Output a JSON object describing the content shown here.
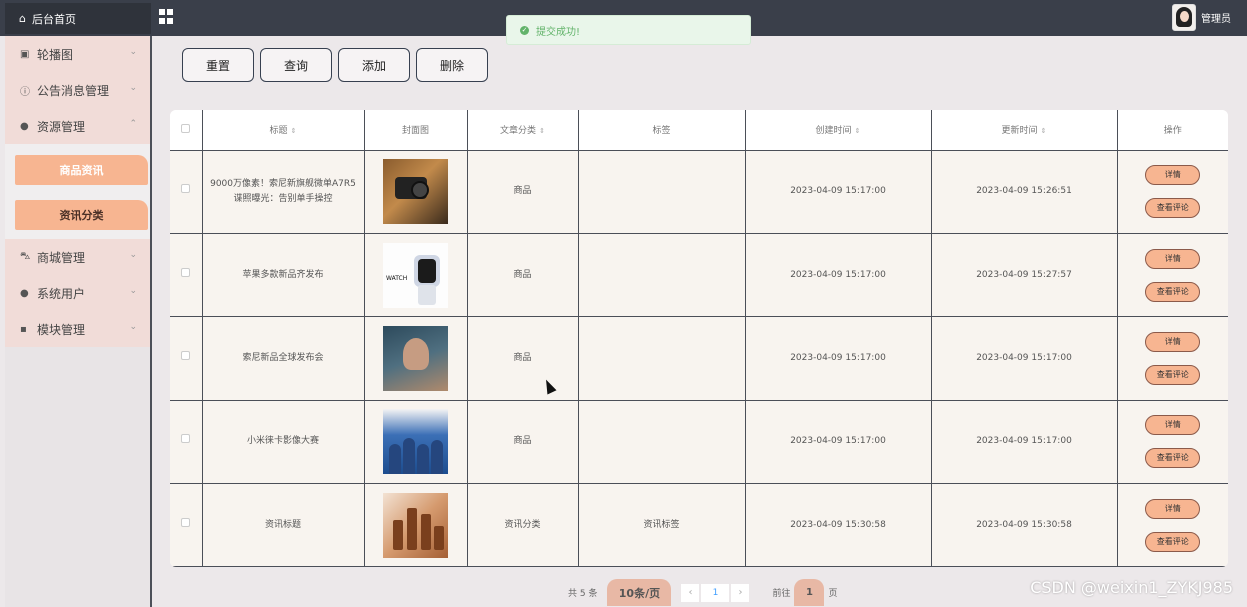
{
  "topbar": {
    "home_label": "后台首页",
    "admin_label": "管理员",
    "toast_text": "提交成功!",
    "toast_color": "#62b36a"
  },
  "sidebar": {
    "items": [
      {
        "label": "轮播图",
        "icon": "image-icon"
      },
      {
        "label": "公告消息管理",
        "icon": "info-circle-icon"
      },
      {
        "label": "资源管理",
        "icon": "location-icon"
      },
      {
        "label": "商城管理",
        "icon": "cart-icon"
      },
      {
        "label": "系统用户",
        "icon": "user-icon"
      },
      {
        "label": "模块管理",
        "icon": "grid-icon"
      }
    ],
    "submenu": [
      "商品资讯",
      "资讯分类"
    ],
    "accent": "#f7b591"
  },
  "actions": {
    "reset": "重置",
    "query": "查询",
    "add": "添加",
    "delete": "删除"
  },
  "table": {
    "headers": {
      "title": "标题",
      "cover": "封面图",
      "category": "文章分类",
      "tags": "标签",
      "created": "创建时间",
      "updated": "更新时间",
      "ops": "操作"
    },
    "detail_label": "详情",
    "comments_label": "查看评论",
    "rows": [
      {
        "title": "9000万像素！索尼新旗舰微单A7R5谍照曝光：告别单手操控",
        "category": "商品",
        "tags": "",
        "created": "2023-04-09 15:17:00",
        "updated": "2023-04-09 15:26:51"
      },
      {
        "title": "苹果多款新品齐发布",
        "category": "商品",
        "tags": "",
        "created": "2023-04-09 15:17:00",
        "updated": "2023-04-09 15:27:57"
      },
      {
        "title": "索尼新品全球发布会",
        "category": "商品",
        "tags": "",
        "created": "2023-04-09 15:17:00",
        "updated": "2023-04-09 15:17:00"
      },
      {
        "title": "小米徕卡影像大赛",
        "category": "商品",
        "tags": "",
        "created": "2023-04-09 15:17:00",
        "updated": "2023-04-09 15:17:00"
      },
      {
        "title": "资讯标题",
        "category": "资讯分类",
        "tags": "资讯标签",
        "created": "2023-04-09 15:30:58",
        "updated": "2023-04-09 15:30:58"
      }
    ],
    "cover_watch_text": "WATCH"
  },
  "pagination": {
    "total": "共 5 条",
    "page_size": "10条/页",
    "prev": "‹",
    "current": "1",
    "next": "›",
    "goto": "前往",
    "goto_value": "1",
    "page_suffix": "页"
  },
  "watermark": "CSDN @weixin1_ZYKJ985"
}
